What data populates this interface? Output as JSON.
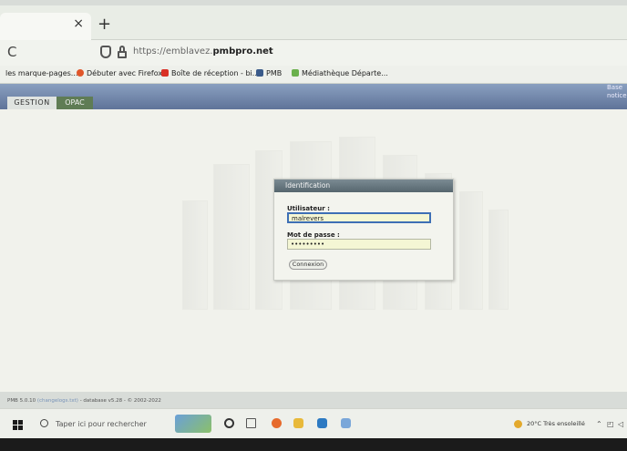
{
  "browser": {
    "tab_close": "×",
    "new_tab": "+",
    "reload": "C",
    "url_prefix": "https://emblavez.",
    "url_domain": "pmbpro.net"
  },
  "bookmarks": [
    {
      "label": "les marque-pages...",
      "icon": "none"
    },
    {
      "label": "Débuter avec Firefox",
      "icon": "firefox-icon",
      "color": "#e0562a"
    },
    {
      "label": "Boîte de réception - bi...",
      "icon": "gmail-icon",
      "color": "#d93025"
    },
    {
      "label": "PMB",
      "icon": "pmb-icon",
      "color": "#3a5a8a"
    },
    {
      "label": "Médiathèque Départe...",
      "icon": "library-icon",
      "color": "#6ab04c"
    }
  ],
  "app": {
    "top_right": [
      "Base",
      "notice"
    ],
    "tabs": [
      {
        "label": "GESTION"
      },
      {
        "label": "OPAC"
      }
    ]
  },
  "login": {
    "title": "Identification",
    "user_label": "Utilisateur :",
    "user_value": "malrevers",
    "password_label": "Mot de passe :",
    "password_value": "•••••••••",
    "submit_label": "Connexion"
  },
  "footer": {
    "version": "PMB 5.0.10",
    "changelog": "(changelogs.txt)",
    "database": "- database v5.28 - © 2002-2022"
  },
  "taskbar": {
    "search_placeholder": "Taper ici pour rechercher",
    "weather": "20°C  Très ensoleillé"
  }
}
